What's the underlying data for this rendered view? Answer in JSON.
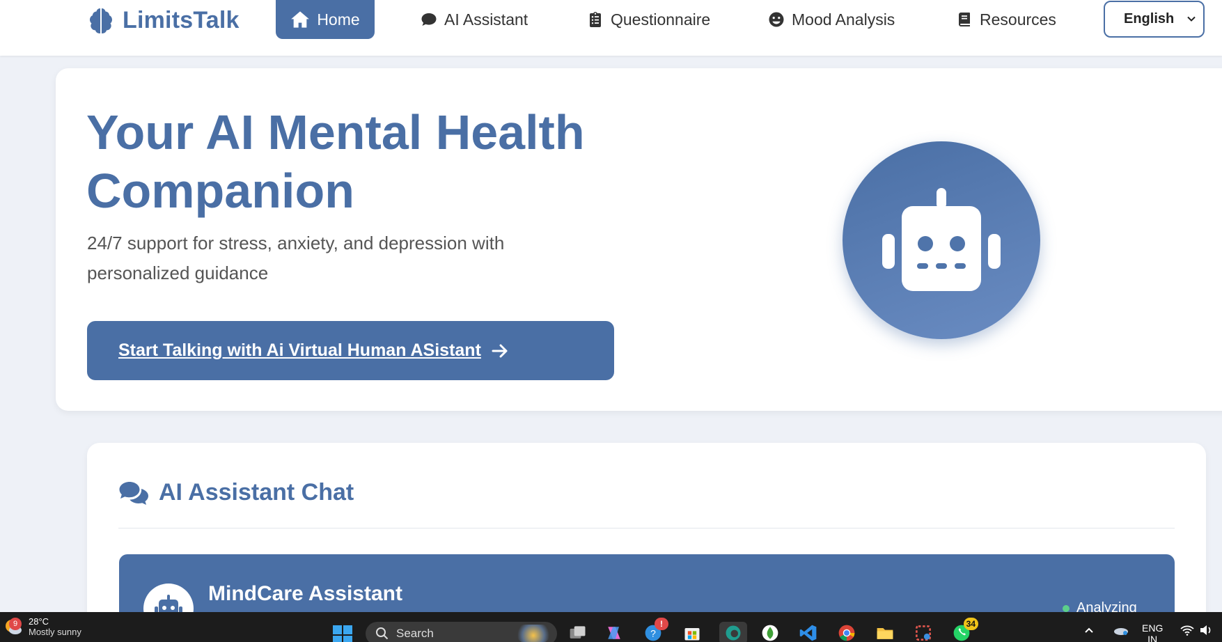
{
  "navbar": {
    "brand": "LimitsTalk",
    "items": [
      {
        "label": "Home",
        "icon": "home-icon",
        "active": true
      },
      {
        "label": "AI Assistant",
        "icon": "chat-bubble-icon"
      },
      {
        "label": "Questionnaire",
        "icon": "clipboard-icon"
      },
      {
        "label": "Mood Analysis",
        "icon": "smile-icon"
      },
      {
        "label": "Resources",
        "icon": "book-icon"
      }
    ],
    "language": "English"
  },
  "hero": {
    "title": "Your AI Mental Health Companion",
    "subtitle": "24/7 support for stress, anxiety, and depression with personalized guidance",
    "cta_label": "Start Talking with Ai Virtual Human ASistant"
  },
  "chat": {
    "heading": "AI Assistant Chat",
    "bot_name": "MindCare Assistant",
    "status": "Analyzing"
  },
  "taskbar": {
    "weather_temp": "28°C",
    "weather_desc": "Mostly sunny",
    "weather_badge": "9",
    "search_placeholder": "Search",
    "whatsapp_badge": "34",
    "lang_line1": "ENG",
    "lang_line2": "IN"
  },
  "colors": {
    "primary": "#4a6fa5",
    "background": "#eef1f7",
    "taskbar": "#1c1c1c"
  }
}
